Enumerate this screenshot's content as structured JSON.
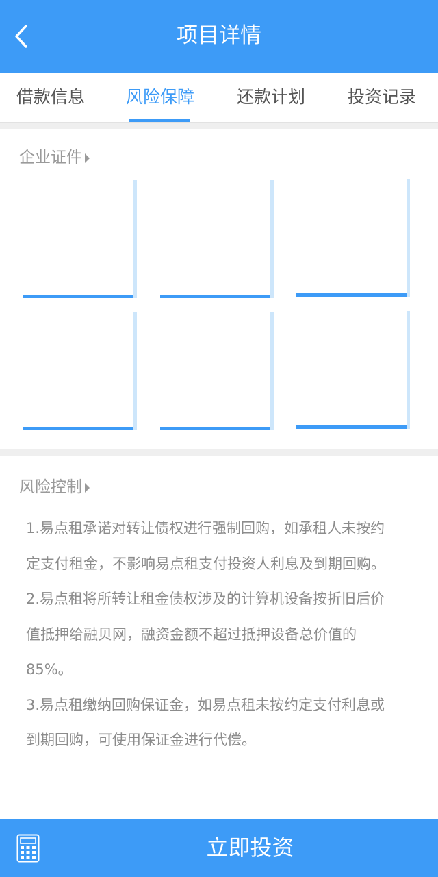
{
  "header": {
    "title": "项目详情",
    "back_icon": "chevron-left-icon"
  },
  "tabs": [
    {
      "label": "借款信息",
      "active": false
    },
    {
      "label": "风险保障",
      "active": true
    },
    {
      "label": "还款计划",
      "active": false
    },
    {
      "label": "投资记录",
      "active": false
    }
  ],
  "certificates": {
    "title": "企业证件",
    "count": 6
  },
  "risk_control": {
    "title": "风险控制",
    "lines": [
      "1.易点租承诺对转让债权进行强制回购，如承租人未按约",
      "定支付租金，不影响易点租支付投资人利息及到期回购。",
      "2.易点租将所转让租金债权涉及的计算机设备按折旧后价",
      "值抵押给融贝网，融资金额不超过抵押设备总价值的",
      "85%。",
      "3.易点租缴纳回购保证金，如易点租未按约定支付利息或",
      "到期回购，可使用保证金进行代偿。"
    ]
  },
  "bottom": {
    "calc_icon": "calculator-icon",
    "invest_label": "立即投资"
  },
  "colors": {
    "primary": "#3d9bf7",
    "light": "#cde6fb",
    "text_gray": "#8c8c8c"
  }
}
